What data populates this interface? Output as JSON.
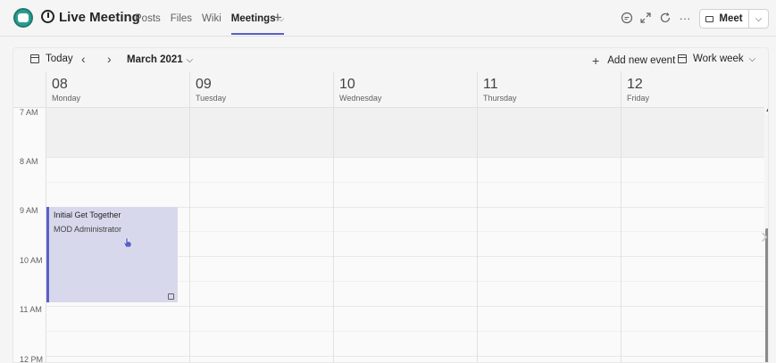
{
  "app": {
    "title": "Live Meeting",
    "tabs": [
      {
        "label": "Posts"
      },
      {
        "label": "Files"
      },
      {
        "label": "Wiki"
      },
      {
        "label": "Meetings",
        "active": true
      }
    ],
    "add_tab_icon": "+",
    "toolbar_icons": [
      "chat-icon",
      "expand-icon",
      "refresh-icon",
      "more-icon"
    ],
    "meet_label": "Meet",
    "accent": "#5b5fc7"
  },
  "calendar": {
    "today_label": "Today",
    "month_label": "March 2021",
    "add_event_label": "Add new event",
    "view_label": "Work week",
    "days": [
      {
        "num": "08",
        "name": "Monday"
      },
      {
        "num": "09",
        "name": "Tuesday"
      },
      {
        "num": "10",
        "name": "Wednesday"
      },
      {
        "num": "11",
        "name": "Thursday"
      },
      {
        "num": "12",
        "name": "Friday"
      }
    ],
    "times": [
      "7 AM",
      "8 AM",
      "9 AM",
      "10 AM",
      "11 AM",
      "12 PM"
    ],
    "event": {
      "title": "Initial Get Together",
      "organizer": "MOD Administrator",
      "color": "#d8d8ec"
    }
  }
}
